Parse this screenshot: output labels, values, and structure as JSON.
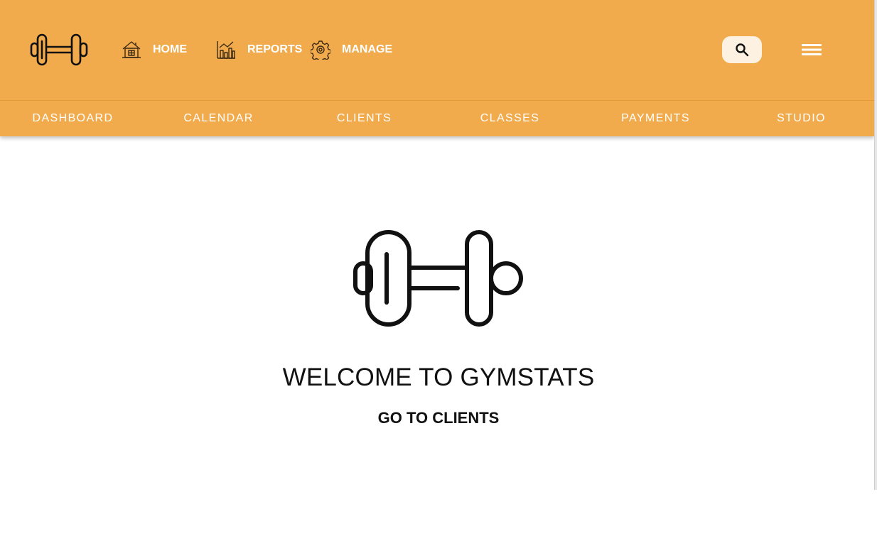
{
  "colors": {
    "header_bg": "#f2ab4c",
    "search_bg": "#fdf1e1",
    "nav_text": "#ffffff",
    "icon_ink": "#111111"
  },
  "header": {
    "logo_icon": "dumbbell-icon",
    "nav": [
      {
        "label": "HOME",
        "icon": "house-icon"
      },
      {
        "label": "REPORTS",
        "icon": "bar-chart-icon"
      },
      {
        "label": "MANAGE",
        "icon": "gear-icon"
      }
    ],
    "search_icon": "search-icon",
    "menu_icon": "hamburger-menu-icon"
  },
  "tabs": [
    {
      "label": "DASHBOARD"
    },
    {
      "label": "CALENDAR"
    },
    {
      "label": "CLIENTS"
    },
    {
      "label": "CLASSES"
    },
    {
      "label": "PAYMENTS"
    },
    {
      "label": "STUDIO"
    }
  ],
  "main": {
    "hero_icon": "dumbbell-icon",
    "title": "WELCOME TO GYMSTATS",
    "cta_label": "GO TO CLIENTS"
  }
}
